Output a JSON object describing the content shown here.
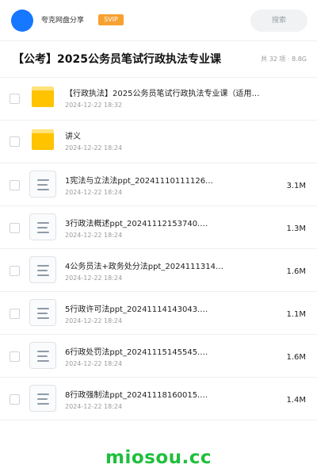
{
  "header": {
    "share_name": "夸克网盘分享",
    "badge": "SVIP",
    "search_placeholder": "搜索",
    "colors": {
      "avatar": "#1677ff",
      "badge": "#f7a131"
    }
  },
  "share": {
    "title": "【公考】2025公务员笔试行政执法专业课",
    "meta": "共 32 项 · 8.8G"
  },
  "items": [
    {
      "type": "folder",
      "icon": "folder-icon",
      "name": "【行政执法】2025公务员笔试行政执法专业课（适用…",
      "date": "2024-12-22 18:32",
      "size": ""
    },
    {
      "type": "folder",
      "icon": "folder-icon",
      "name": "讲义",
      "date": "2024-12-22 18:24",
      "size": ""
    },
    {
      "type": "file",
      "icon": "document-icon",
      "name": "1宪法与立法法ppt_20241110111126…",
      "date": "2024-12-22 18:24",
      "size": "3.1M"
    },
    {
      "type": "file",
      "icon": "document-icon",
      "name": "3行政法概述ppt_20241112153740.…",
      "date": "2024-12-22 18:24",
      "size": "1.3M"
    },
    {
      "type": "file",
      "icon": "document-icon",
      "name": "4公务员法+政务处分法ppt_2024111314…",
      "date": "2024-12-22 18:24",
      "size": "1.6M"
    },
    {
      "type": "file",
      "icon": "document-icon",
      "name": "5行政许可法ppt_20241114143043.…",
      "date": "2024-12-22 18:24",
      "size": "1.1M"
    },
    {
      "type": "file",
      "icon": "document-icon",
      "name": "6行政处罚法ppt_20241115145545.…",
      "date": "2024-12-22 18:24",
      "size": "1.6M"
    },
    {
      "type": "file",
      "icon": "document-icon",
      "name": "8行政强制法ppt_20241118160015.…",
      "date": "2024-12-22 18:24",
      "size": "1.4M"
    }
  ],
  "watermark": "miosou.cc",
  "colors": {
    "folder": "#ffc300",
    "folder_tab": "#ffe27a",
    "watermark": "#1fbf3c"
  }
}
